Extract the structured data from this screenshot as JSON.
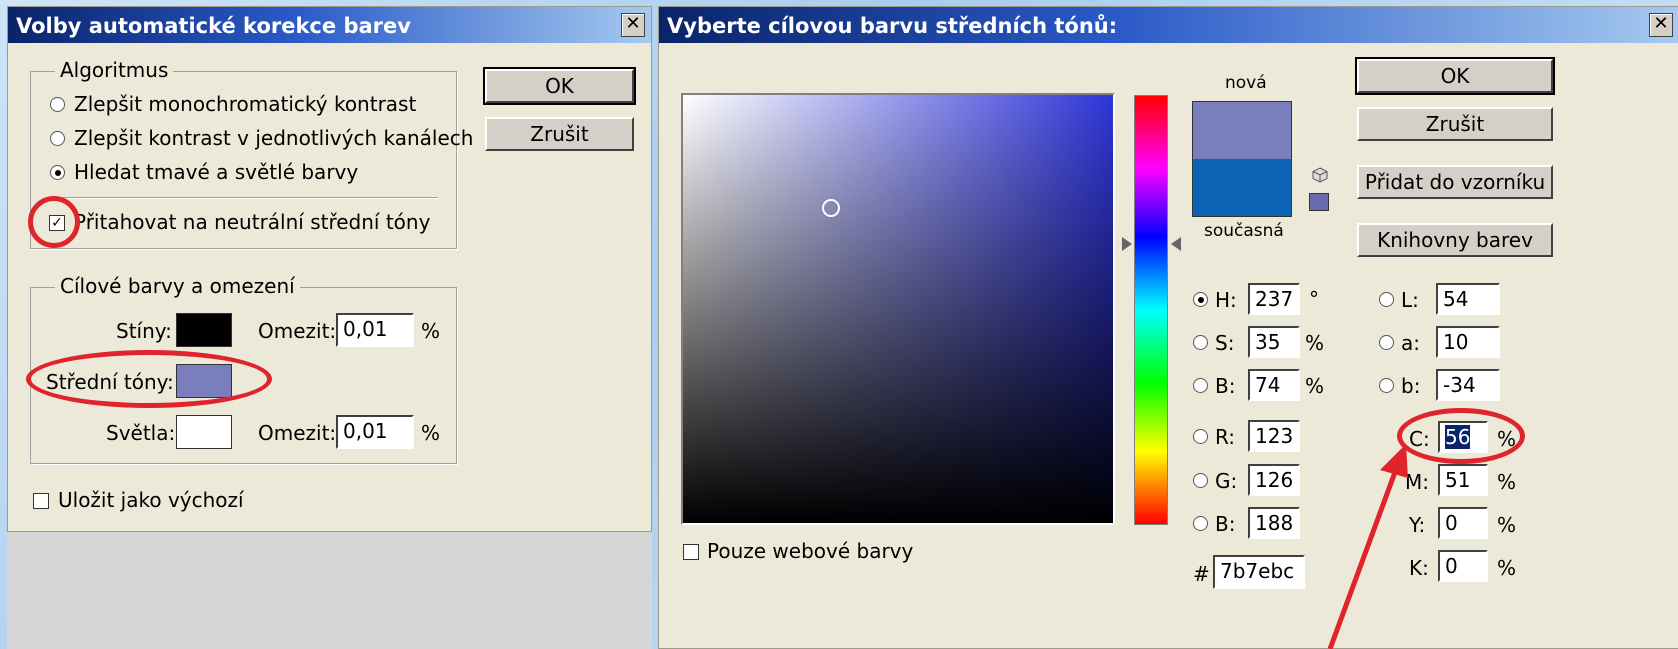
{
  "left_dialog": {
    "title": "Volby automatické korekce barev",
    "close_glyph": "✕",
    "ok_label": "OK",
    "cancel_label": "Zrušit",
    "algorithm_group": "Algoritmus",
    "algorithms": [
      {
        "label": "Zlepšit monochromatický kontrast",
        "selected": false
      },
      {
        "label": "Zlepšit kontrast v jednotlivých kanálech",
        "selected": false
      },
      {
        "label": "Hledat tmavé a světlé barvy",
        "selected": true
      }
    ],
    "snap_neutral_label": "Přitahovat na neutrální střední tóny",
    "snap_neutral_checked": true,
    "targets_group": "Cílové barvy a omezení",
    "shadows_label": "Stíny:",
    "shadows_color": "#000000",
    "clip_label": "Omezit:",
    "shadows_clip": "0,01",
    "percent": "%",
    "midtones_label": "Střední tóny:",
    "midtones_color": "#7b7ebc",
    "highlights_label": "Světla:",
    "highlights_color": "#ffffff",
    "highlights_clip": "0,01",
    "save_default_label": "Uložit jako výchozí",
    "save_default_checked": false
  },
  "picker": {
    "title": "Vyberte cílovou barvu středních tónů:",
    "close_glyph": "✕",
    "new_label": "nová",
    "current_label": "současná",
    "new_color": "#7b7ebc",
    "current_color": "#0a63b4",
    "ok_label": "OK",
    "cancel_label": "Zrušit",
    "add_swatch_label": "Přidat do vzorníku",
    "libraries_label": "Knihovny barev",
    "web_only_label": "Pouze webové barvy",
    "hue_color": "#3a3ae0",
    "hsb": [
      {
        "label": "H:",
        "value": "237",
        "unit": "°",
        "selected": true
      },
      {
        "label": "S:",
        "value": "35",
        "unit": "%",
        "selected": false
      },
      {
        "label": "B:",
        "value": "74",
        "unit": "%",
        "selected": false
      }
    ],
    "rgb": [
      {
        "label": "R:",
        "value": "123"
      },
      {
        "label": "G:",
        "value": "126"
      },
      {
        "label": "B:",
        "value": "188"
      }
    ],
    "hex_label": "#",
    "hex_value": "7b7ebc",
    "lab": [
      {
        "label": "L:",
        "value": "54"
      },
      {
        "label": "a:",
        "value": "10"
      },
      {
        "label": "b:",
        "value": "-34"
      }
    ],
    "cmyk": [
      {
        "label": "C:",
        "value": "56",
        "unit": "%"
      },
      {
        "label": "M:",
        "value": "51",
        "unit": "%"
      },
      {
        "label": "Y:",
        "value": "0",
        "unit": "%"
      },
      {
        "label": "K:",
        "value": "0",
        "unit": "%"
      }
    ]
  },
  "annotation_color": "#e0242b"
}
